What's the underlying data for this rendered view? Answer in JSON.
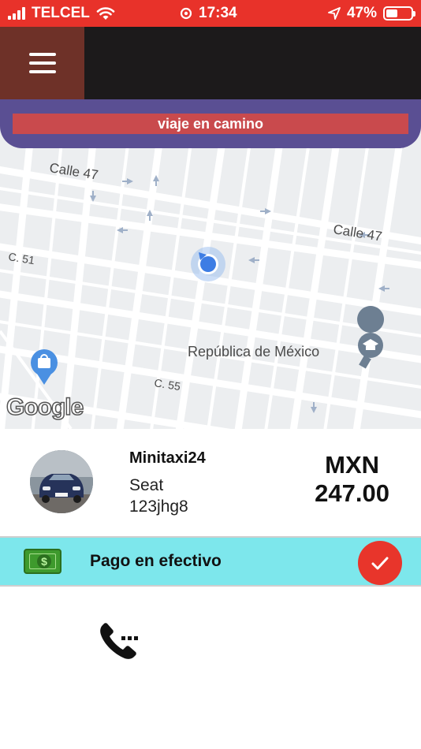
{
  "status_bar": {
    "carrier": "TELCEL",
    "time": "17:34",
    "battery": "47%"
  },
  "header": {
    "menu_icon": "hamburger-menu-icon"
  },
  "banner": {
    "label": "viaje en camino"
  },
  "map": {
    "labels": {
      "street_1": "Calle 47",
      "street_2": "Calle 47",
      "street_3": "C. 51",
      "street_4": "C. 55",
      "poi": "República de México"
    },
    "logo": "Google"
  },
  "driver": {
    "name": "Minitaxi24",
    "car_model": "Seat",
    "plate": "123jhg8"
  },
  "fare": {
    "currency": "MXN",
    "amount": "247.00"
  },
  "payment": {
    "label": "Pago en efectivo",
    "icon": "cash-icon",
    "confirm_icon": "check-icon"
  },
  "actions": {
    "call_icon": "phone-icon"
  },
  "colors": {
    "status_bar": "#e8322a",
    "header": "#1c1a1b",
    "menu_button": "#6e3128",
    "banner": "#5a4f93",
    "banner_label": "#c94a4d",
    "payment_bar": "#7de7ec",
    "confirm_button": "#e8352b"
  }
}
